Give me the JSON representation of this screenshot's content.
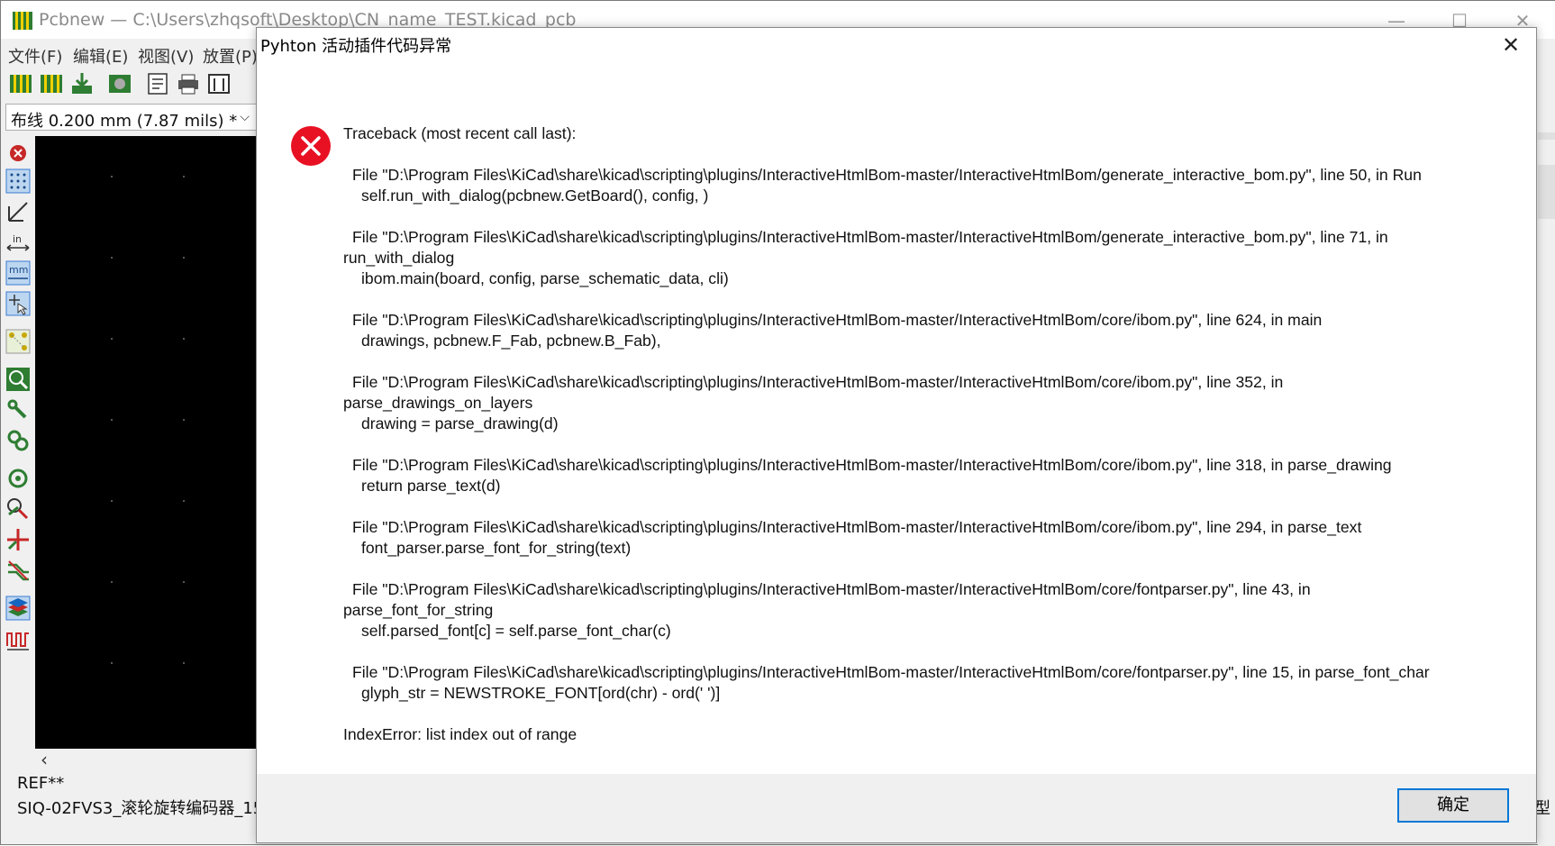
{
  "app": {
    "title": "Pcbnew — C:\\Users\\zhqsoft\\Desktop\\CN_name_TEST.kicad_pcb",
    "window_buttons": {
      "minimize": "—",
      "maximize": "☐",
      "close": "✕"
    },
    "menu": [
      "文件(F)",
      "编辑(E)",
      "视图(V)",
      "放置(P)"
    ],
    "layer_select": {
      "value": "布线 0.200 mm (7.87 mils) *"
    },
    "status": {
      "line1": "REF**",
      "line2": "SIQ-02FVS3_滚轮旋转编码器_15",
      "right": "型"
    }
  },
  "dialog": {
    "title": "Pyhton 活动插件代码异常",
    "close_label": "✕",
    "traceback": {
      "header": "Traceback (most recent call last):",
      "frames": [
        {
          "file": "File \"D:\\Program Files\\KiCad\\share\\kicad\\scripting\\plugins/InteractiveHtmlBom-master/InteractiveHtmlBom/generate_interactive_bom.py\", line 50, in Run",
          "cont": "",
          "code": "self.run_with_dialog(pcbnew.GetBoard(), config, )"
        },
        {
          "file": "File \"D:\\Program Files\\KiCad\\share\\kicad\\scripting\\plugins/InteractiveHtmlBom-master/InteractiveHtmlBom/generate_interactive_bom.py\", line 71, in",
          "cont": "run_with_dialog",
          "code": "ibom.main(board, config, parse_schematic_data, cli)"
        },
        {
          "file": "File \"D:\\Program Files\\KiCad\\share\\kicad\\scripting\\plugins/InteractiveHtmlBom-master/InteractiveHtmlBom/core/ibom.py\", line 624, in main",
          "cont": "",
          "code": "drawings, pcbnew.F_Fab, pcbnew.B_Fab),"
        },
        {
          "file": "File \"D:\\Program Files\\KiCad\\share\\kicad\\scripting\\plugins/InteractiveHtmlBom-master/InteractiveHtmlBom/core/ibom.py\", line 352, in",
          "cont": "parse_drawings_on_layers",
          "code": "drawing = parse_drawing(d)"
        },
        {
          "file": "File \"D:\\Program Files\\KiCad\\share\\kicad\\scripting\\plugins/InteractiveHtmlBom-master/InteractiveHtmlBom/core/ibom.py\", line 318, in parse_drawing",
          "cont": "",
          "code": "return parse_text(d)"
        },
        {
          "file": "File \"D:\\Program Files\\KiCad\\share\\kicad\\scripting\\plugins/InteractiveHtmlBom-master/InteractiveHtmlBom/core/ibom.py\", line 294, in parse_text",
          "cont": "",
          "code": "font_parser.parse_font_for_string(text)"
        },
        {
          "file": "File \"D:\\Program Files\\KiCad\\share\\kicad\\scripting\\plugins/InteractiveHtmlBom-master/InteractiveHtmlBom/core/fontparser.py\", line 43, in",
          "cont": "parse_font_for_string",
          "code": "self.parsed_font[c] = self.parse_font_char(c)"
        },
        {
          "file": "File \"D:\\Program Files\\KiCad\\share\\kicad\\scripting\\plugins/InteractiveHtmlBom-master/InteractiveHtmlBom/core/fontparser.py\", line 15, in parse_font_char",
          "cont": "",
          "code": "glyph_str = NEWSTROKE_FONT[ord(chr) - ord(' ')]"
        }
      ],
      "error": "IndexError: list index out of range"
    },
    "ok_label": "确定"
  },
  "colors": {
    "error_red": "#e81123",
    "accent_blue": "#0078d7",
    "pcb_green": "#2e7d32"
  }
}
